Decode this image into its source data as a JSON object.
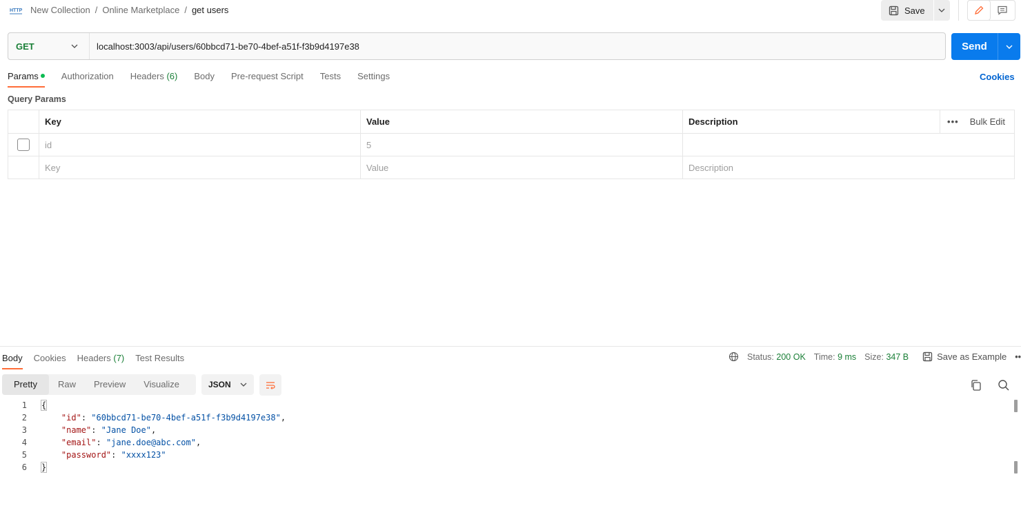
{
  "header": {
    "icon": "http-request-icon",
    "breadcrumb": [
      "New Collection",
      "Online Marketplace",
      "get users"
    ],
    "separator": "/",
    "save_label": "Save"
  },
  "request": {
    "method": "GET",
    "url": "localhost:3003/api/users/60bbcd71-be70-4bef-a51f-f3b9d4197e38",
    "send_label": "Send"
  },
  "request_tabs": {
    "params": "Params",
    "authorization": "Authorization",
    "headers": "Headers",
    "headers_count": "(6)",
    "body": "Body",
    "prerequest": "Pre-request Script",
    "tests": "Tests",
    "settings": "Settings",
    "cookies": "Cookies"
  },
  "query_params": {
    "title": "Query Params",
    "columns": {
      "key": "Key",
      "value": "Value",
      "description": "Description"
    },
    "bulk_edit": "Bulk Edit",
    "more": "•••",
    "rows": [
      {
        "key": "id",
        "value": "5",
        "description": "",
        "checked": false
      }
    ],
    "placeholder": {
      "key": "Key",
      "value": "Value",
      "description": "Description"
    }
  },
  "response": {
    "tabs": {
      "body": "Body",
      "cookies": "Cookies",
      "headers": "Headers",
      "headers_count": "(7)",
      "test_results": "Test Results"
    },
    "status_label": "Status:",
    "status_value": "200 OK",
    "time_label": "Time:",
    "time_value": "9 ms",
    "size_label": "Size:",
    "size_value": "347 B",
    "save_example": "Save as Example",
    "more": "•••",
    "views": [
      "Pretty",
      "Raw",
      "Preview",
      "Visualize"
    ],
    "format": "JSON",
    "lines": [
      "1",
      "2",
      "3",
      "4",
      "5",
      "6"
    ],
    "json": {
      "open": "{",
      "close": "}",
      "fields": [
        {
          "key": "\"id\"",
          "value": "\"60bbcd71-be70-4bef-a51f-f3b9d4197e38\"",
          "trail": ","
        },
        {
          "key": "\"name\"",
          "value": "\"Jane Doe\"",
          "trail": ","
        },
        {
          "key": "\"email\"",
          "value": "\"jane.doe@abc.com\"",
          "trail": ","
        },
        {
          "key": "\"password\"",
          "value": "\"xxxx123\"",
          "trail": ""
        }
      ]
    }
  },
  "colors": {
    "accent": "#ff6c37",
    "send": "#097bed",
    "method_get": "#1a7f37",
    "status_ok": "#1a7f37",
    "link": "#0265d2"
  }
}
